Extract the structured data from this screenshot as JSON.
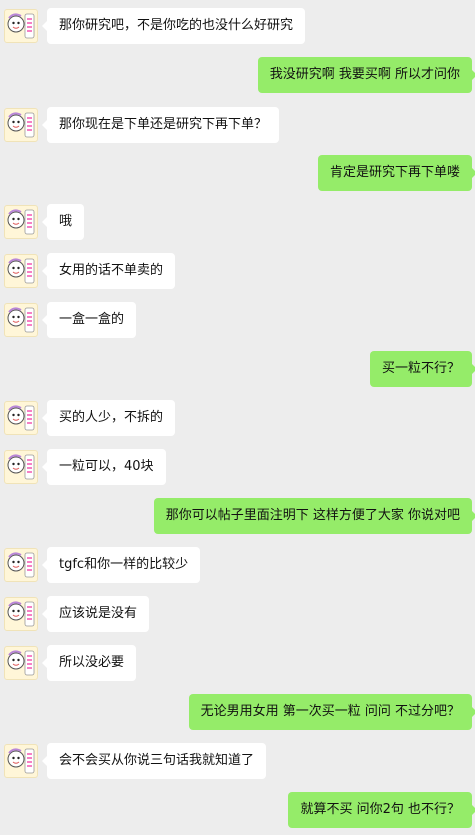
{
  "conversation": {
    "messages": [
      {
        "side": "left",
        "text": "那你研究吧，不是你吃的也没什么好研究"
      },
      {
        "side": "right",
        "text": "我没研究啊 我要买啊 所以才问你"
      },
      {
        "side": "left",
        "text": "那你现在是下单还是研究下再下单？"
      },
      {
        "side": "right",
        "text": "肯定是研究下再下单喽"
      },
      {
        "side": "left",
        "text": "哦"
      },
      {
        "side": "left",
        "text": "女用的话不单卖的"
      },
      {
        "side": "left",
        "text": "一盒一盒的"
      },
      {
        "side": "right",
        "text": "买一粒不行？"
      },
      {
        "side": "left",
        "text": "买的人少，不拆的"
      },
      {
        "side": "left",
        "text": "一粒可以，40块"
      },
      {
        "side": "right",
        "text": "那你可以帖子里面注明下 这样方便了大家 你说对吧"
      },
      {
        "side": "left",
        "text": "tgfc和你一样的比较少"
      },
      {
        "side": "left",
        "text": "应该说是没有"
      },
      {
        "side": "left",
        "text": "所以没必要"
      },
      {
        "side": "right",
        "text": "无论男用女用 第一次买一粒 问问 不过分吧？"
      },
      {
        "side": "left",
        "text": "会不会买从你说三句话我就知道了"
      },
      {
        "side": "right",
        "text": "就算不买 问你2句 也不行？"
      }
    ]
  },
  "colors": {
    "background": "#ededed",
    "incoming_bubble": "#ffffff",
    "outgoing_bubble": "#95ec69",
    "text": "#111111"
  },
  "icons": {
    "contact_avatar": "cartoon-character-avatar-icon"
  }
}
